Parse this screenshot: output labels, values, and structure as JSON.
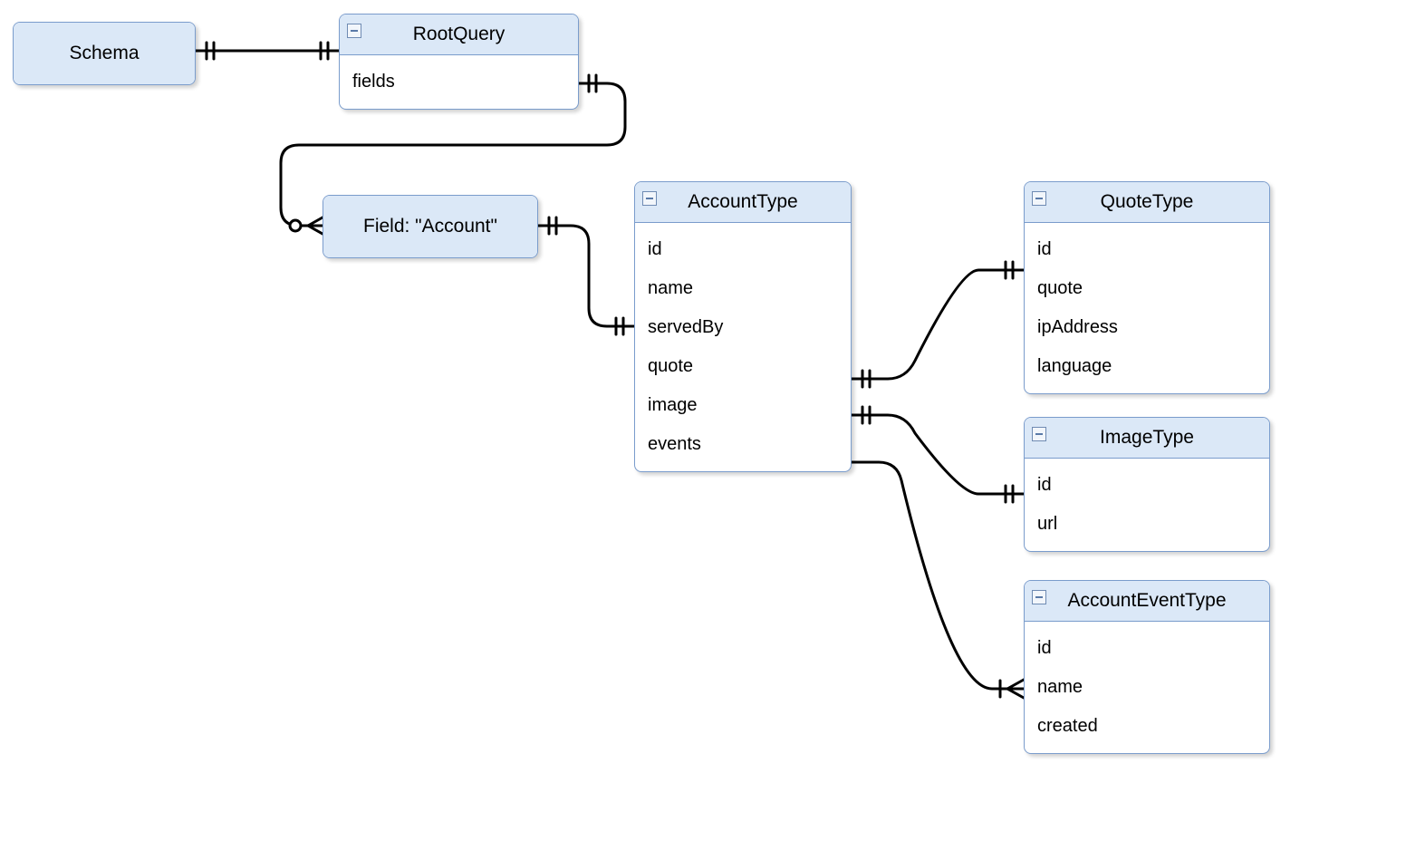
{
  "entities": {
    "schema": {
      "title": "Schema"
    },
    "rootQuery": {
      "title": "RootQuery",
      "rows": [
        "fields"
      ]
    },
    "fieldAccount": {
      "title": "Field: \"Account\""
    },
    "accountType": {
      "title": "AccountType",
      "rows": [
        "id",
        "name",
        "servedBy",
        "quote",
        "image",
        "events"
      ]
    },
    "quoteType": {
      "title": "QuoteType",
      "rows": [
        "id",
        "quote",
        "ipAddress",
        "language"
      ]
    },
    "imageType": {
      "title": "ImageType",
      "rows": [
        "id",
        "url"
      ]
    },
    "accountEventType": {
      "title": "AccountEventType",
      "rows": [
        "id",
        "name",
        "created"
      ]
    }
  }
}
